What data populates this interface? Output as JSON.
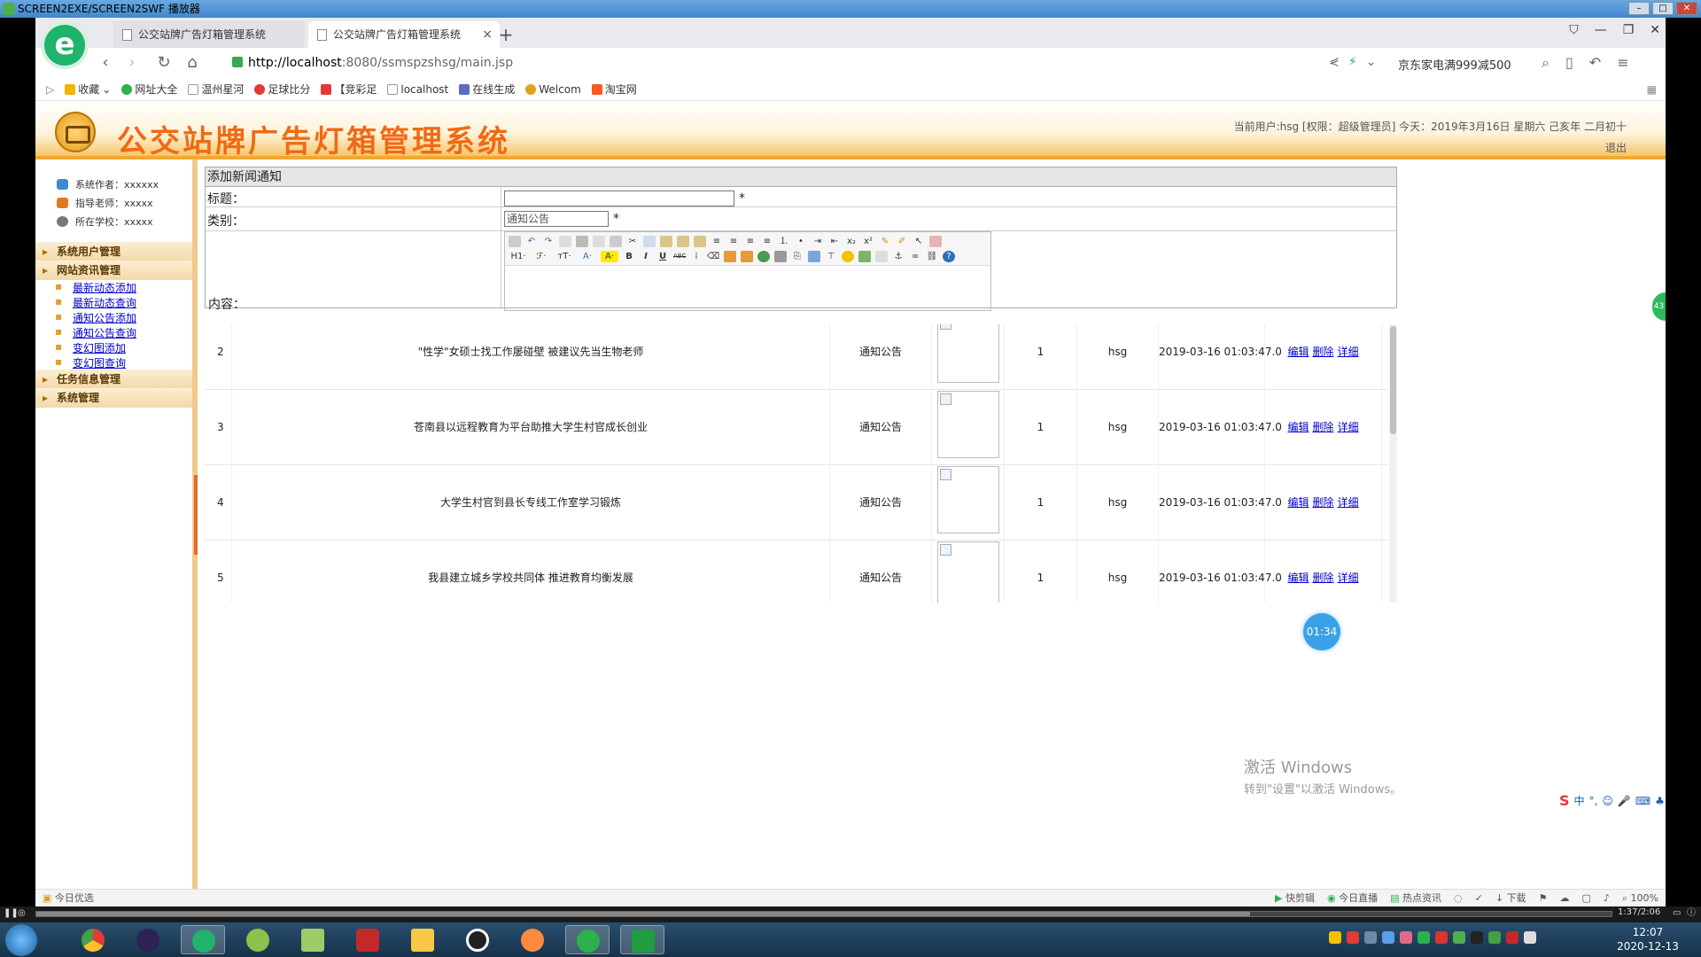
{
  "player": {
    "title": "SCREEN2EXE/SCREEN2SWF 播放器",
    "time": "1:37/2:06"
  },
  "browser": {
    "tabs": [
      {
        "label": "公交站牌广告灯箱管理系统"
      },
      {
        "label": "公交站牌广告灯箱管理系统"
      }
    ],
    "url_host": "http://localhost",
    "url_path": ":8080/ssmspzshsg/main.jsp",
    "promo": "京东家电满999减500",
    "bookmarks": [
      "收藏",
      "网址大全",
      "温州星河",
      "足球比分",
      "【竞彩足",
      "localhost",
      "在线生成",
      "Welcom",
      "淘宝网"
    ]
  },
  "app": {
    "title": "公交站牌广告灯箱管理系统",
    "user_info": "当前用户:hsg [权限：超级管理员] 今天：2019年3月16日 星期六 己亥年 二月初十",
    "logout": "退出"
  },
  "sidebar": {
    "info": [
      {
        "label": "系统作者：xxxxxx",
        "color": "#3a8ad6"
      },
      {
        "label": "指导老师：xxxxx",
        "color": "#e07a1a"
      },
      {
        "label": "所在学校：xxxxx",
        "color": "#777777"
      }
    ],
    "menus": {
      "users": "系统用户管理",
      "news": "网站资讯管理",
      "tasks": "任务信息管理",
      "system": "系统管理"
    },
    "news_items": [
      "最新动态添加",
      "最新动态查询",
      "通知公告添加",
      "通知公告查询",
      "变幻图添加",
      "变幻图查询"
    ]
  },
  "form": {
    "heading": "添加新闻通知",
    "title_label": "标题：",
    "category_label": "类别：",
    "category_value": "通知公告",
    "content_label": "内容：",
    "required_mark": "*",
    "toolbar_row2": {
      "h1": "H1·",
      "font": "ℱ·",
      "size": "тT·",
      "color": "A·",
      "hl": "A·",
      "bold": "B",
      "italic": "I",
      "underline": "U",
      "strike": "ABC"
    }
  },
  "list": {
    "rows": [
      {
        "id": "2",
        "title": "\"性学\"女硕士找工作屡碰壁 被建议先当生物老师",
        "category": "通知公告",
        "count": "1",
        "author": "hsg",
        "time": "2019-03-16 01:03:47.0"
      },
      {
        "id": "3",
        "title": "苍南县以远程教育为平台助推大学生村官成长创业",
        "category": "通知公告",
        "count": "1",
        "author": "hsg",
        "time": "2019-03-16 01:03:47.0"
      },
      {
        "id": "4",
        "title": "大学生村官到县长专线工作室学习锻炼",
        "category": "通知公告",
        "count": "1",
        "author": "hsg",
        "time": "2019-03-16 01:03:47.0"
      },
      {
        "id": "5",
        "title": "我县建立城乡学校共同体 推进教育均衡发展",
        "category": "通知公告",
        "count": "1",
        "author": "hsg",
        "time": "2019-03-16 01:03:47.0"
      }
    ],
    "ops": {
      "edit": "编辑",
      "delete": "删除",
      "detail": "详细"
    }
  },
  "overlay": {
    "timer": "01:34",
    "green_tab": "43",
    "activate_line1": "激活 Windows",
    "activate_line2": "转到\"设置\"以激活 Windows。",
    "ime": "中"
  },
  "statusbar": {
    "left": "今日优选",
    "right": [
      "快剪辑",
      "今日直播",
      "热点资讯",
      "下载",
      "100%"
    ]
  },
  "taskbar": {
    "time": "12:07",
    "date": "2020-12-13"
  }
}
